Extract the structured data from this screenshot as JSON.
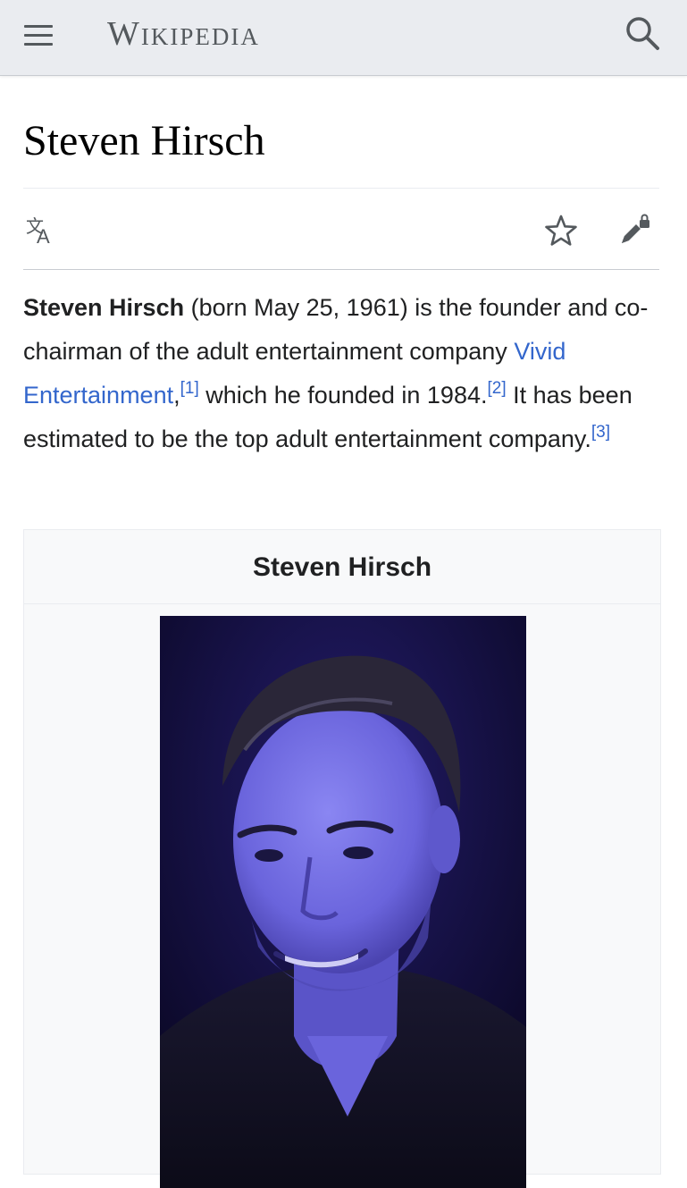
{
  "header": {
    "wordmark": "Wikipedia",
    "menu_icon": "hamburger-menu-icon",
    "search_icon": "search-icon"
  },
  "article": {
    "title": "Steven Hirsch",
    "actions": {
      "language_icon": "translate-icon",
      "watch_icon": "star-icon",
      "edit_icon": "edit-lock-icon"
    },
    "intro": {
      "name": "Steven Hirsch",
      "t1": " (born May 25, 1961) is the founder and co-chairman of the adult entertainment company ",
      "link": "Vivid Entertainment",
      "t2": ",",
      "ref1": "[1]",
      "t3": " which he founded in 1984.",
      "ref2": "[2]",
      "t4": " It has been estimated to be the top adult entertainment company.",
      "ref3": "[3]"
    },
    "infobox": {
      "title": "Steven Hirsch",
      "image": "portrait-photo"
    }
  },
  "colors": {
    "header_bg": "#eaecf0",
    "link": "#3366cc",
    "text": "#202122",
    "icon": "#54595d"
  }
}
